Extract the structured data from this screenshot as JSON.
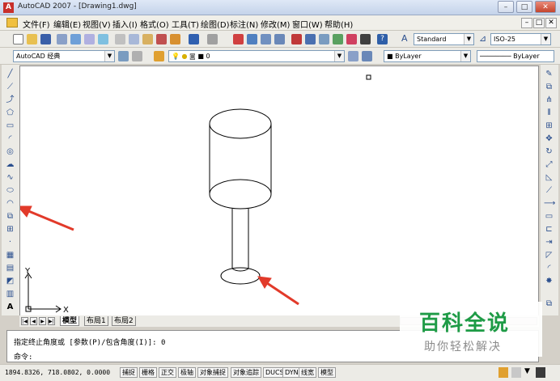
{
  "window": {
    "title": "AutoCAD 2007 - [Drawing1.dwg]",
    "app_icon": "acad-icon",
    "minimize": "–",
    "maximize": "□",
    "close": "✕"
  },
  "menu": {
    "items": [
      "文件(F)",
      "编辑(E)",
      "视图(V)",
      "插入(I)",
      "格式(O)",
      "工具(T)",
      "绘图(D)",
      "标注(N)",
      "修改(M)",
      "窗口(W)",
      "帮助(H)"
    ],
    "doc_minimize": "–",
    "doc_restore": "□",
    "doc_close": "✕"
  },
  "styles": {
    "text_style": "Standard",
    "dim_style": "ISO-25"
  },
  "workspace": {
    "name": "AutoCAD 经典"
  },
  "layers": {
    "current": "0"
  },
  "properties": {
    "color": "ByLayer",
    "linetype": "ByLayer"
  },
  "canvas": {
    "ucs_y": "Y",
    "ucs_x": "X"
  },
  "tabs": {
    "items": [
      "模型",
      "布局1",
      "布局2"
    ]
  },
  "command": {
    "history": "指定终止角度或 [参数(P)/包含角度(I)]: 0",
    "prompt": "命令:"
  },
  "status": {
    "coords": "1894.8326, 718.0802, 0.0000",
    "buttons": [
      "捕捉",
      "栅格",
      "正交",
      "极轴",
      "对象捕捉",
      "对象追踪",
      "DUCS",
      "DYN",
      "线宽",
      "模型"
    ]
  },
  "watermark": {
    "title": "百科全说",
    "subtitle": "助你轻松解决"
  },
  "colors": {
    "annotation_arrow": "#e23a2a",
    "watermark_green": "#1e9b46",
    "canvas_bg": "#ffffff"
  }
}
